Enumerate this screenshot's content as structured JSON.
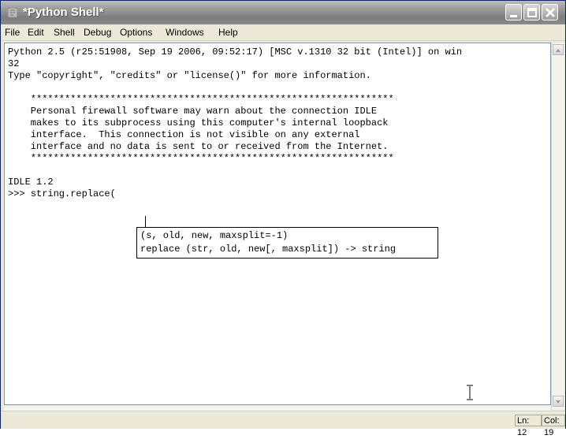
{
  "window": {
    "title": "*Python Shell*"
  },
  "menubar": {
    "items": [
      "File",
      "Edit",
      "Shell",
      "Debug",
      "Options",
      "Windows",
      "Help"
    ]
  },
  "shell": {
    "lines": [
      "Python 2.5 (r25:51908, Sep 19 2006, 09:52:17) [MSC v.1310 32 bit (Intel)] on win",
      "32",
      "Type \"copyright\", \"credits\" or \"license()\" for more information.",
      "",
      "    ****************************************************************",
      "    Personal firewall software may warn about the connection IDLE",
      "    makes to its subprocess using this computer's internal loopback",
      "    interface.  This connection is not visible on any external",
      "    interface and no data is sent to or received from the Internet.",
      "    ****************************************************************",
      "",
      "IDLE 1.2",
      ">>> string.replace("
    ]
  },
  "calltip": {
    "lines": [
      "(s, old, new, maxsplit=-1)",
      "replace (str, old, new[, maxsplit]) -> string"
    ]
  },
  "status": {
    "line": "Ln: 12",
    "col": "Col: 19"
  }
}
